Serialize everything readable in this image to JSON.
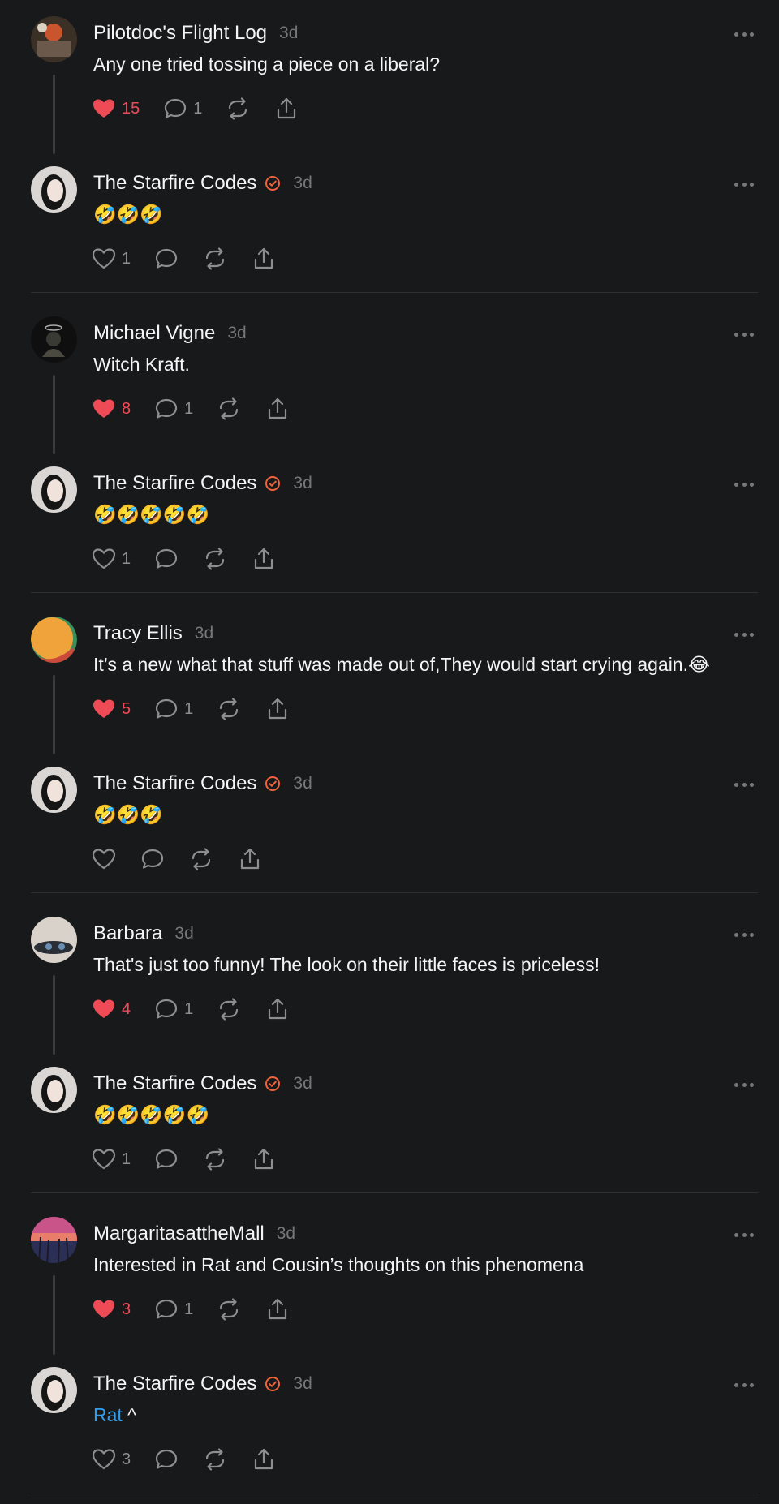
{
  "colors": {
    "background": "#18191b",
    "text": "#f3f5f7",
    "muted": "#777777",
    "like": "#ef4b57",
    "verified": "#f0633a",
    "link": "#2d9ef0"
  },
  "posts": [
    {
      "author": "Pilotdoc's Flight Log",
      "time": "3d",
      "verified": false,
      "text": "Any one tried tossing a piece on a liberal?",
      "likes": "15",
      "liked": true,
      "replies": "1",
      "avatar": "pilot"
    },
    {
      "author": "The Starfire Codes",
      "time": "3d",
      "verified": true,
      "text": "🤣🤣🤣",
      "likes": "1",
      "liked": false,
      "replies": "",
      "avatar": "starfire"
    },
    {
      "author": "Michael Vigne",
      "time": "3d",
      "verified": false,
      "text": "Witch Kraft.",
      "likes": "8",
      "liked": true,
      "replies": "1",
      "avatar": "michael"
    },
    {
      "author": "The Starfire Codes",
      "time": "3d",
      "verified": true,
      "text": "🤣🤣🤣🤣🤣",
      "likes": "1",
      "liked": false,
      "replies": "",
      "avatar": "starfire"
    },
    {
      "author": "Tracy Ellis",
      "time": "3d",
      "verified": false,
      "text": "It’s a new what that stuff was made out of,They would start crying again.😂",
      "likes": "5",
      "liked": true,
      "replies": "1",
      "avatar": "tracy"
    },
    {
      "author": "The Starfire Codes",
      "time": "3d",
      "verified": true,
      "text": "🤣🤣🤣",
      "likes": "",
      "liked": false,
      "replies": "",
      "avatar": "starfire"
    },
    {
      "author": "Barbara",
      "time": "3d",
      "verified": false,
      "text": "That's just too funny! The look on their little faces is priceless!",
      "likes": "4",
      "liked": true,
      "replies": "1",
      "avatar": "barbara"
    },
    {
      "author": "The Starfire Codes",
      "time": "3d",
      "verified": true,
      "text": "🤣🤣🤣🤣🤣",
      "likes": "1",
      "liked": false,
      "replies": "",
      "avatar": "starfire"
    },
    {
      "author": "MargaritasattheMall",
      "time": "3d",
      "verified": false,
      "text": "Interested in Rat and Cousin’s thoughts on this phenomena",
      "likes": "3",
      "liked": true,
      "replies": "1",
      "avatar": "margarita"
    },
    {
      "author": "The Starfire Codes",
      "time": "3d",
      "verified": true,
      "text_link": "Rat",
      "text": " ^",
      "likes": "3",
      "liked": false,
      "replies": "",
      "avatar": "starfire"
    }
  ],
  "icons": {
    "like": "heart-icon",
    "reply": "comment-icon",
    "repost": "repost-icon",
    "share": "share-icon",
    "more": "more-icon",
    "verified": "verified-badge-icon"
  }
}
